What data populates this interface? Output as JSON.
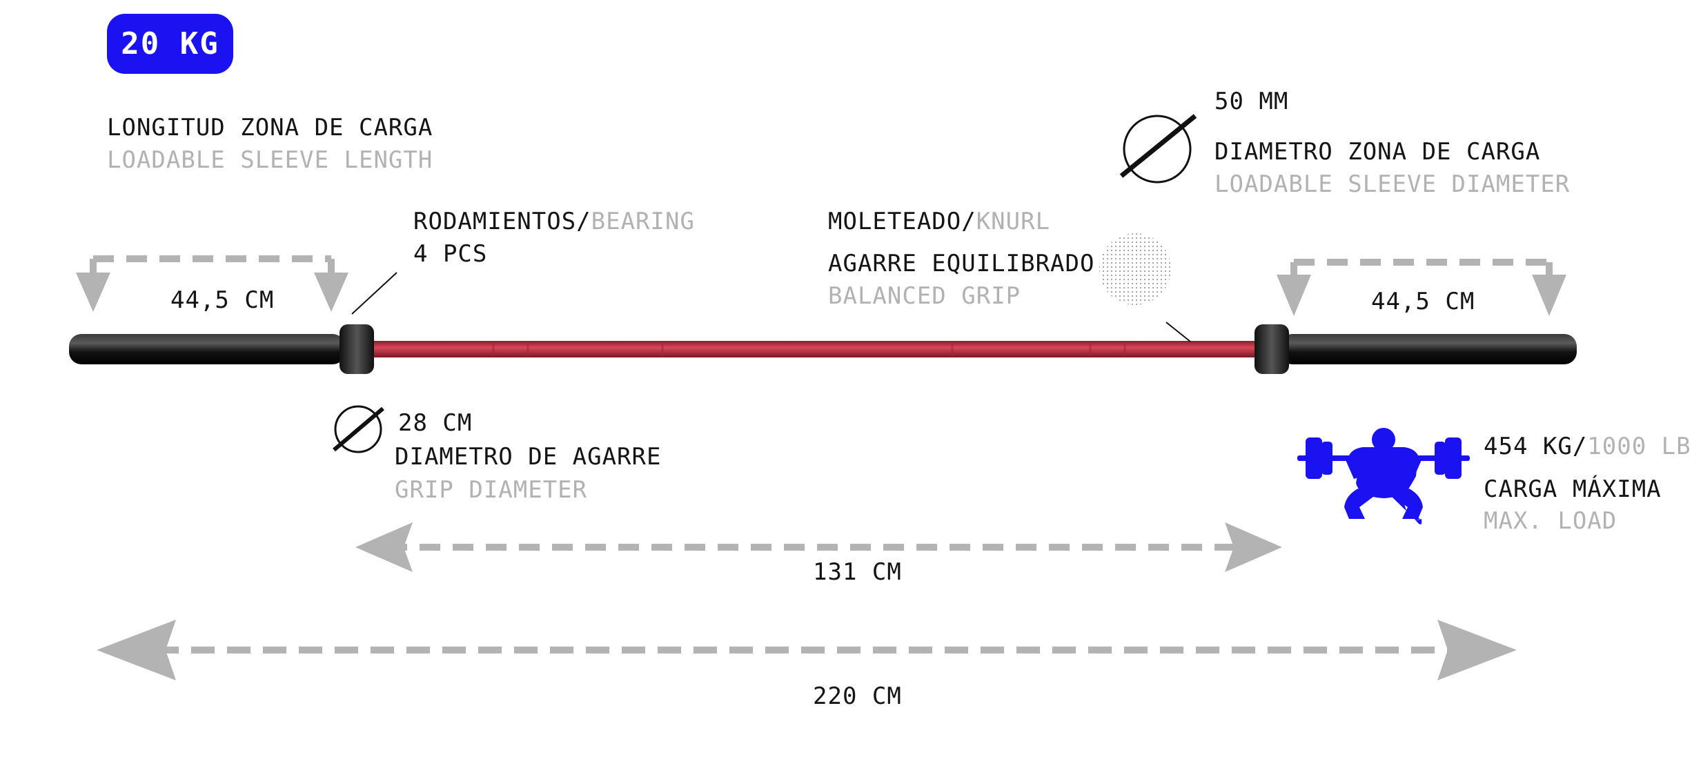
{
  "weight_badge": "20 KG",
  "sleeve_length": {
    "es": "LONGITUD ZONA DE CARGA",
    "en": "LOADABLE SLEEVE LENGTH",
    "value": "44,5 CM"
  },
  "bearing": {
    "es": "RODAMIENTOS/",
    "en": "BEARING",
    "value": "4 PCS"
  },
  "knurl": {
    "es": "MOLETEADO/",
    "en": "KNURL",
    "grip_es": "AGARRE EQUILIBRADO",
    "grip_en": "BALANCED GRIP"
  },
  "sleeve_diameter": {
    "value": "50 MM",
    "es": "DIAMETRO ZONA DE CARGA",
    "en": "LOADABLE SLEEVE DIAMETER"
  },
  "grip_diameter": {
    "value": "28 CM",
    "es": "DIAMETRO DE AGARRE",
    "en": "GRIP DIAMETER"
  },
  "max_load": {
    "kg": "454 KG/",
    "lb": "1000 LB",
    "es": "CARGA MÁXIMA",
    "en": "MAX. LOAD"
  },
  "grip_length": "131 CM",
  "total_length": "220 CM",
  "colors": {
    "badge": "#1a12f0",
    "shaft": "#c8303c",
    "sleeve": "#1a1a1a",
    "arrow": "#b3b3b3",
    "icon": "#1a12f0"
  },
  "icons": [
    "diameter-icon",
    "knurl-texture-icon",
    "squat-lifter-icon"
  ]
}
